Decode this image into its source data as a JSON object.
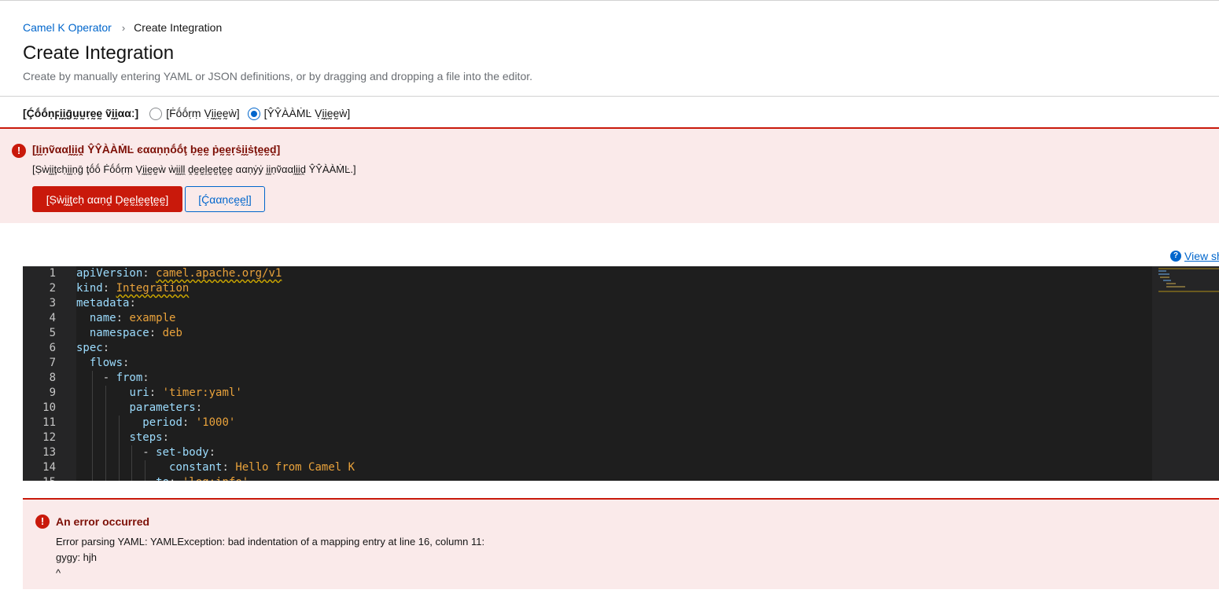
{
  "breadcrumb": {
    "parent": "Camel K Operator",
    "separator_icon": "chevron-right-icon",
    "current": "Create Integration"
  },
  "header": {
    "title": "Create Integration",
    "subtitle": "Create by manually entering YAML or JSON definitions, or by dragging and dropping a file into the editor."
  },
  "configure": {
    "label": "[Ḉṓṓṇϝḭḭḡṵṵṛḛḛ ṽḭḭααː]",
    "options": [
      {
        "label": "[Ḟṓṓṛṃ Ṿḭḭḛḛẁ]",
        "selected": false
      },
      {
        "label": "[ŶŶÀÀṀĿ Ṿḭḭḛḛẁ]",
        "selected": true
      }
    ]
  },
  "switch_alert": {
    "icon": "exclamation-circle-icon",
    "title": "[Ḭḭṇṽααḽḭḭḓ ŶŶÀÀṀĿ ͼααṇṇṓṓţ ḅḛḛ ṗḛḛṛṡḭḭṡţḛḛḓ]",
    "body": "[Ṣẁḭḭţͼḥḭḭṇḡ ţṓṓ Ḟṓṓṛṃ Ṿḭḭḛḛẁ ẁḭḭḽḽ ḓḛḛḽḛḛţḛḛ ααṇẏẏ ḭḭṇṽααḽḭḭḓ ŶŶÀÀṀĿ.]",
    "primary_button": "[Ṣẁḭḭţͼḥ ααṇḓ Ḍḛḛḽḛḛţḛḛ]",
    "secondary_button": "[Ḉααṇͼḛḛḽ]",
    "color": "#c9190b"
  },
  "shortcuts_link": "View sh",
  "editor": {
    "lines": [
      {
        "n": "1",
        "indent": 0,
        "key": "apiVersion",
        "value": "camel.apache.org/v1",
        "vtype": "squig"
      },
      {
        "n": "2",
        "indent": 0,
        "key": "kind",
        "value": "Integration",
        "vtype": "squig"
      },
      {
        "n": "3",
        "indent": 0,
        "key": "metadata",
        "value": "",
        "vtype": ""
      },
      {
        "n": "4",
        "indent": 1,
        "key": "name",
        "value": "example",
        "vtype": "plain"
      },
      {
        "n": "5",
        "indent": 1,
        "key": "namespace",
        "value": "deb",
        "vtype": "plain"
      },
      {
        "n": "6",
        "indent": 0,
        "key": "spec",
        "value": "",
        "vtype": ""
      },
      {
        "n": "7",
        "indent": 1,
        "key": "flows",
        "value": "",
        "vtype": ""
      },
      {
        "n": "8",
        "indent": 2,
        "dash": true,
        "key": "from",
        "value": "",
        "vtype": ""
      },
      {
        "n": "9",
        "indent": 4,
        "key": "uri",
        "value": "'timer:yaml'",
        "vtype": "str"
      },
      {
        "n": "10",
        "indent": 4,
        "key": "parameters",
        "value": "",
        "vtype": ""
      },
      {
        "n": "11",
        "indent": 5,
        "key": "period",
        "value": "'1000'",
        "vtype": "str"
      },
      {
        "n": "12",
        "indent": 4,
        "key": "steps",
        "value": "",
        "vtype": ""
      },
      {
        "n": "13",
        "indent": 5,
        "dash": true,
        "key": "set-body",
        "value": "",
        "vtype": ""
      },
      {
        "n": "14",
        "indent": 7,
        "key": "constant",
        "value": "Hello from Camel K",
        "vtype": "plain"
      },
      {
        "n": "15",
        "indent": 6,
        "key": "to",
        "value": "'log:info'",
        "vtype": "str"
      }
    ]
  },
  "error_alert": {
    "icon": "exclamation-circle-icon",
    "title": "An error occurred",
    "body": "Error parsing YAML: YAMLException: bad indentation of a mapping entry at line 16, column 11:\ngygy: hjh\n^",
    "color": "#c9190b"
  }
}
